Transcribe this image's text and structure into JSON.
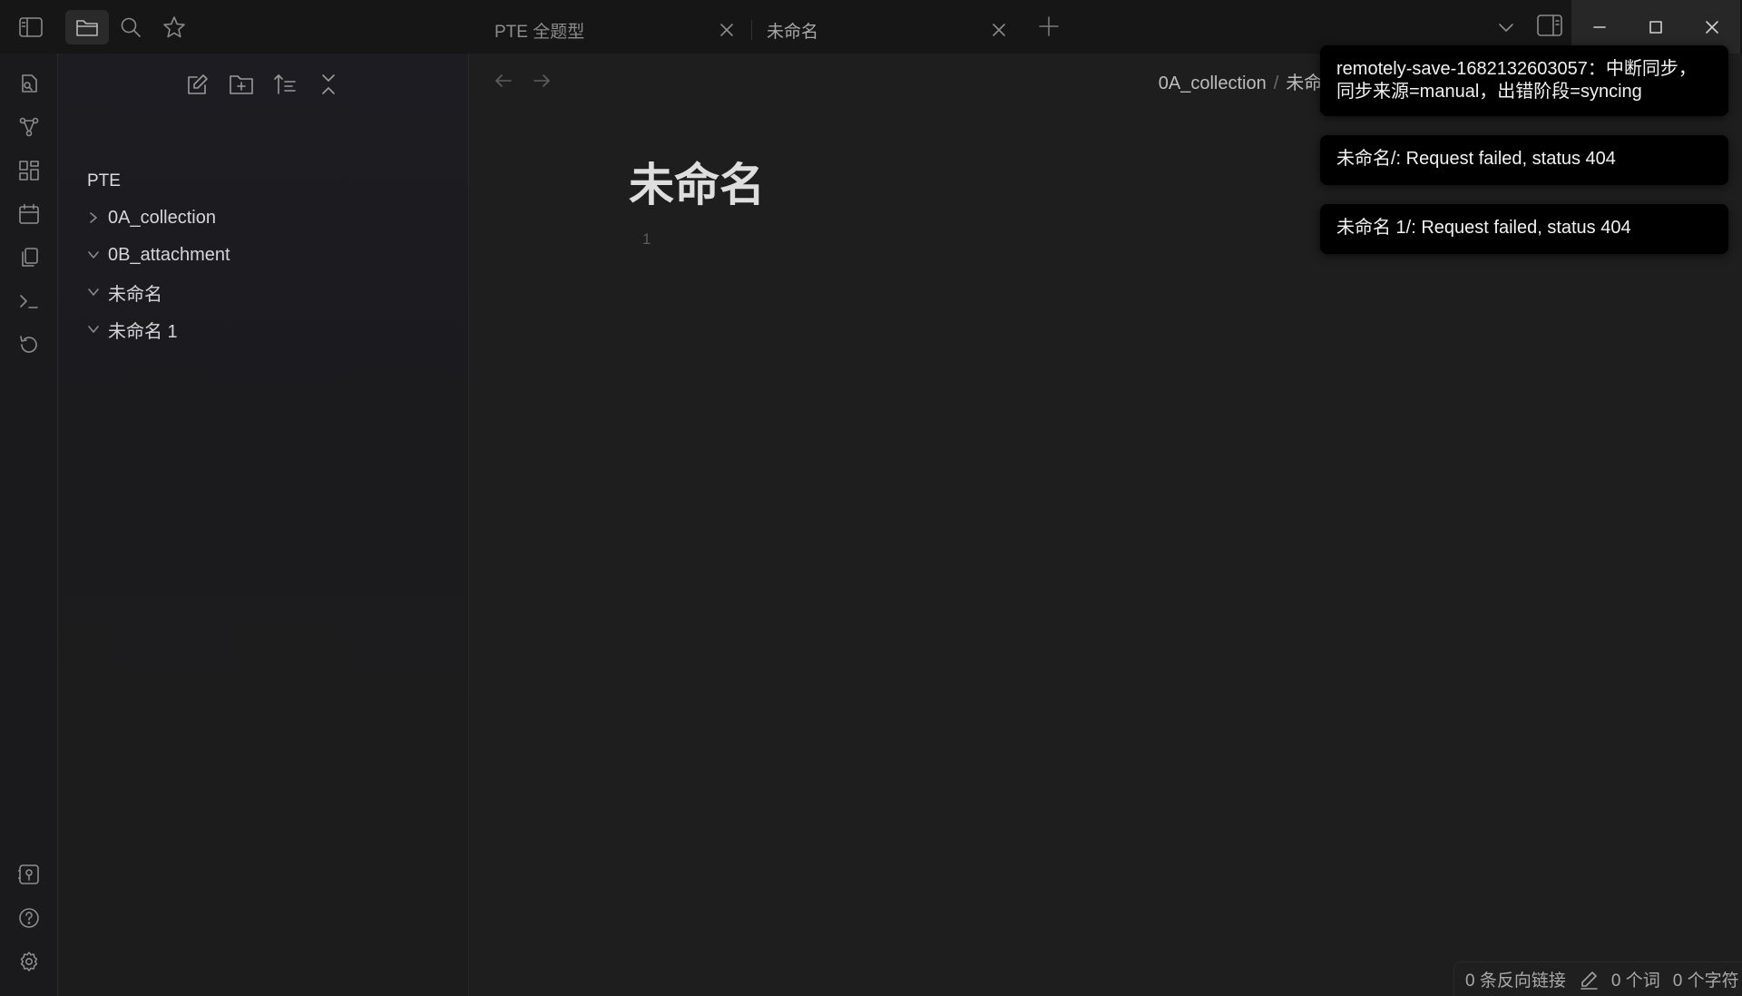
{
  "titlebar": {
    "tabs": [
      {
        "label": "PTE 全题型",
        "active": false
      },
      {
        "label": "未命名",
        "active": true
      }
    ]
  },
  "sidebar": {
    "vault_name": "PTE",
    "tree": [
      {
        "label": "0A_collection",
        "expanded": false
      },
      {
        "label": "0B_attachment",
        "expanded": true
      },
      {
        "label": "未命名",
        "expanded": true
      },
      {
        "label": "未命名 1",
        "expanded": true
      }
    ]
  },
  "main": {
    "breadcrumb": {
      "folder": "0A_collection",
      "separator": "/",
      "file": "未命名"
    },
    "note_title": "未命名",
    "line_number": "1"
  },
  "notices": [
    {
      "line1": "remotely-save-1682132603057：中断同步，",
      "line2": "同步来源=manual，出错阶段=syncing"
    },
    {
      "text": "未命名/: Request failed, status 404"
    },
    {
      "text": "未命名 1/: Request failed, status 404"
    }
  ],
  "statusbar": {
    "backlinks": "0 条反向链接",
    "words": "0 个词",
    "chars": "0 个字符"
  },
  "icons": {
    "titlebar": [
      "sidebar-toggle-icon",
      "folder-icon",
      "search-icon",
      "star-icon"
    ],
    "ribbon_top": [
      "open-quick-switcher-icon",
      "graph-view-icon",
      "canvas-icon",
      "daily-note-icon",
      "templates-icon",
      "command-palette-icon",
      "sync-icon"
    ],
    "ribbon_bottom": [
      "vault-switcher-icon",
      "help-icon",
      "settings-icon"
    ]
  }
}
